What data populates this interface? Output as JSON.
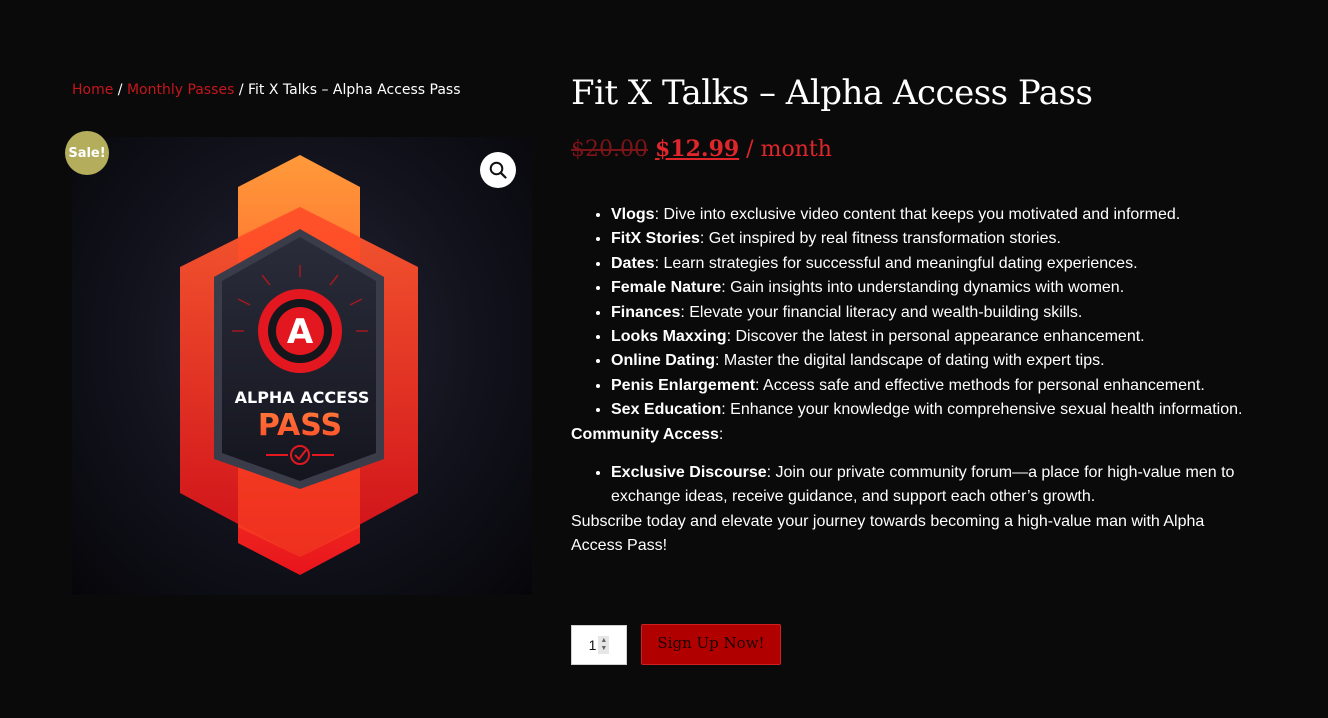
{
  "breadcrumb": {
    "home": "Home",
    "category": "Monthly Passes",
    "separator": "/",
    "current": "Fit X Talks – Alpha Access Pass"
  },
  "product": {
    "title": "Fit X Talks – Alpha Access Pass",
    "sale_badge": "Sale!",
    "image": {
      "badge_letter": "A",
      "line1": "ALPHA ACCESS",
      "line2": "PASS"
    },
    "price": {
      "regular": "$20.00",
      "sale": "$12.99",
      "period": " / month"
    }
  },
  "description": {
    "features": [
      {
        "term": "Vlogs",
        "text": ": Dive into exclusive video content that keeps you motivated and informed."
      },
      {
        "term": "FitX Stories",
        "text": ": Get inspired by real fitness transformation stories."
      },
      {
        "term": "Dates",
        "text": ": Learn strategies for successful and meaningful dating experiences."
      },
      {
        "term": "Female Nature",
        "text": ": Gain insights into understanding dynamics with women."
      },
      {
        "term": "Finances",
        "text": ": Elevate your financial literacy and wealth-building skills."
      },
      {
        "term": "Looks Maxxing",
        "text": ": Discover the latest in personal appearance enhancement."
      },
      {
        "term": "Online Dating",
        "text": ": Master the digital landscape of dating with expert tips."
      },
      {
        "term": "Penis Enlargement",
        "text": ": Access safe and effective methods for personal enhancement."
      },
      {
        "term": "Sex Education",
        "text": ": Enhance your knowledge with comprehensive sexual health information."
      }
    ],
    "community_heading": "Community Access",
    "community_colon": ":",
    "community_items": [
      {
        "term": "Exclusive Discourse",
        "text": ": Join our private community forum—a place for high-value men to exchange ideas, receive guidance, and support each other’s growth."
      }
    ],
    "closing": "Subscribe today and elevate your journey towards becoming a high-value man with Alpha Access Pass!"
  },
  "cart": {
    "quantity": "1",
    "submit_label": "Sign Up Now!"
  },
  "icons": {
    "zoom": "magnifier-icon",
    "quantity_spinner": "spinner-arrows-icon"
  },
  "colors": {
    "background": "#0a0a0a",
    "accent_red": "#c4161c",
    "sale_badge": "#b3ad5c",
    "button": "#b00000"
  }
}
